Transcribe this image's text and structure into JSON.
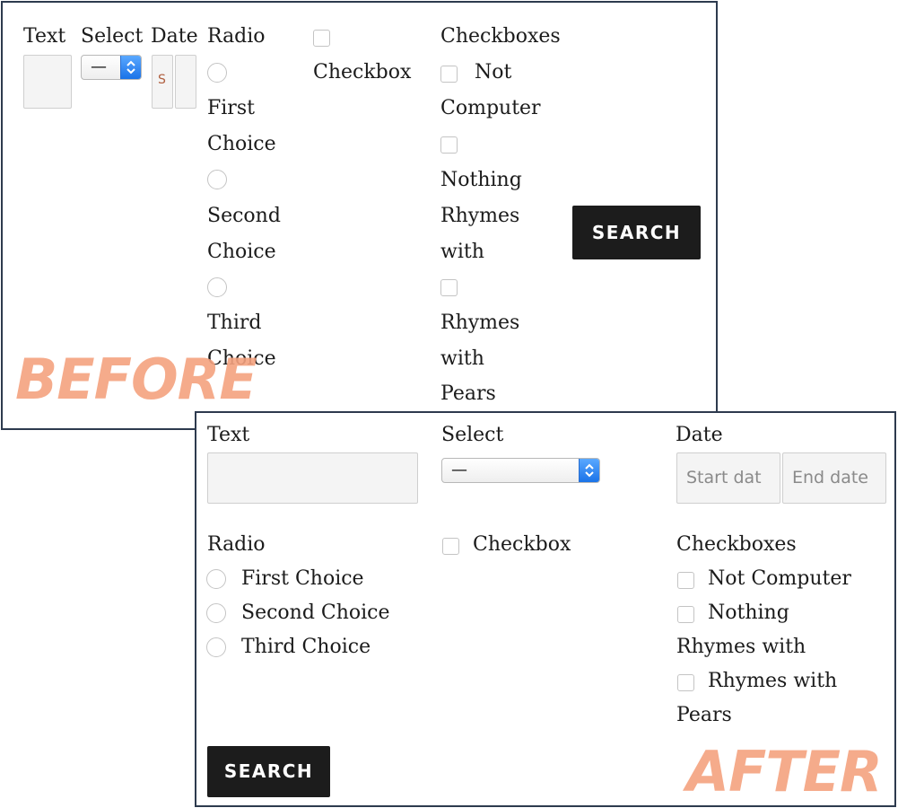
{
  "before": {
    "label_text": "Text",
    "label_select": "Select",
    "label_date": "Date",
    "label_radio": "Radio",
    "select_value": "—",
    "date_partial": "S",
    "radio_options": [
      "First",
      "Choice",
      "Second",
      "Choice",
      "Third",
      "Choice"
    ],
    "checkbox_label": "Checkbox",
    "checkboxes_label": "Checkboxes",
    "checkbox_options": [
      "Not",
      "Computer",
      "Nothing",
      "Rhymes",
      "with",
      "Rhymes",
      "with",
      "Pears"
    ],
    "search_button": "SEARCH",
    "watermark": "BEFORE"
  },
  "after": {
    "label_text": "Text",
    "label_select": "Select",
    "label_date": "Date",
    "select_value": "—",
    "start_date_placeholder": "Start dat",
    "end_date_placeholder": "End date",
    "label_radio": "Radio",
    "radio_options": [
      "First Choice",
      "Second Choice",
      "Third Choice"
    ],
    "checkbox_label": "Checkbox",
    "checkboxes_label": "Checkboxes",
    "checkbox_options": [
      "Not Computer",
      "Nothing",
      "Rhymes with",
      "Rhymes with",
      "Pears"
    ],
    "search_button": "SEARCH",
    "watermark": "AFTER"
  },
  "colors": {
    "watermark": "#f5a27f",
    "border": "#2d3a4e",
    "button": "#1c1c1c",
    "select_accent": "#1a73e8"
  }
}
